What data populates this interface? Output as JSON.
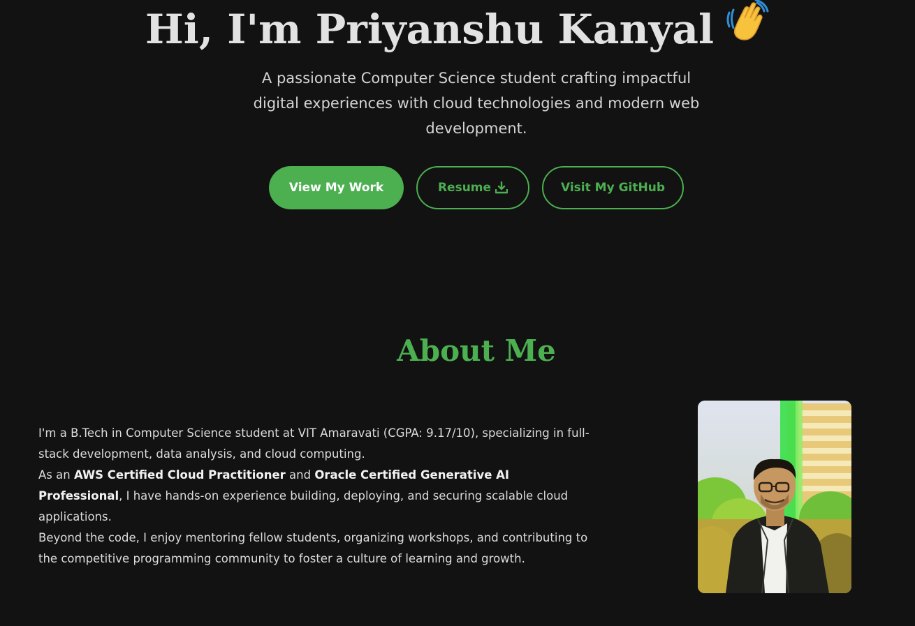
{
  "hero": {
    "greeting": "Hi, I'm Priyanshu Kanyal",
    "wave_icon": "waving-hand-emoji",
    "subtitle_line1": "A passionate Computer Science student crafting impactful",
    "subtitle_line2": "digital experiences with cloud technologies and modern web",
    "subtitle_line3": "development."
  },
  "buttons": {
    "view_work": "View My Work",
    "resume": "Resume",
    "resume_icon": "download-icon",
    "github": "Visit My GitHub"
  },
  "about": {
    "title": "About Me",
    "p1": "I'm a B.Tech in Computer Science student at VIT Amaravati (CGPA: 9.17/10), specializing in full-stack development, data analysis, and cloud computing.",
    "p2_pre": "As an ",
    "p2_cert1": "AWS Certified Cloud Practitioner",
    "p2_mid": " and ",
    "p2_cert2": "Oracle Certified Generative AI Professional",
    "p2_post": ", I have hands-on experience building, deploying, and securing scalable cloud applications.",
    "p3": "Beyond the code, I enjoy mentoring fellow students, organizing workshops, and contributing to the competitive programming community to foster a culture of learning and growth."
  },
  "colors": {
    "background": "#121212",
    "accent": "#4caf50",
    "text": "#e2e2e2"
  }
}
